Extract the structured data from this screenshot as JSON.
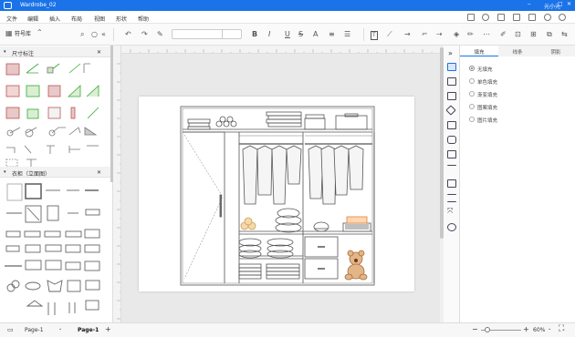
{
  "titlebar": {
    "title": "Wardrobe_02",
    "user": "元小元"
  },
  "menu": [
    "文件",
    "编辑",
    "插入",
    "布局",
    "视图",
    "形状",
    "帮助"
  ],
  "toolbar": {
    "font_value": "",
    "size_value": ""
  },
  "library": {
    "header": "符号库",
    "section1": "尺寸标注",
    "section2": "衣柜（立面图）"
  },
  "right_tabs": [
    "填充",
    "线条",
    "阴影"
  ],
  "fill_options": [
    "无填充",
    "单色填充",
    "渐变填充",
    "图案填充",
    "图片填充"
  ],
  "status": {
    "page_select": "Page-1",
    "page_tab": "Page-1",
    "add": "+",
    "zoom": "60%"
  },
  "colors": {
    "accent": "#1a73e8",
    "rack": "#ff7a3d",
    "bear": "#c98a52"
  }
}
